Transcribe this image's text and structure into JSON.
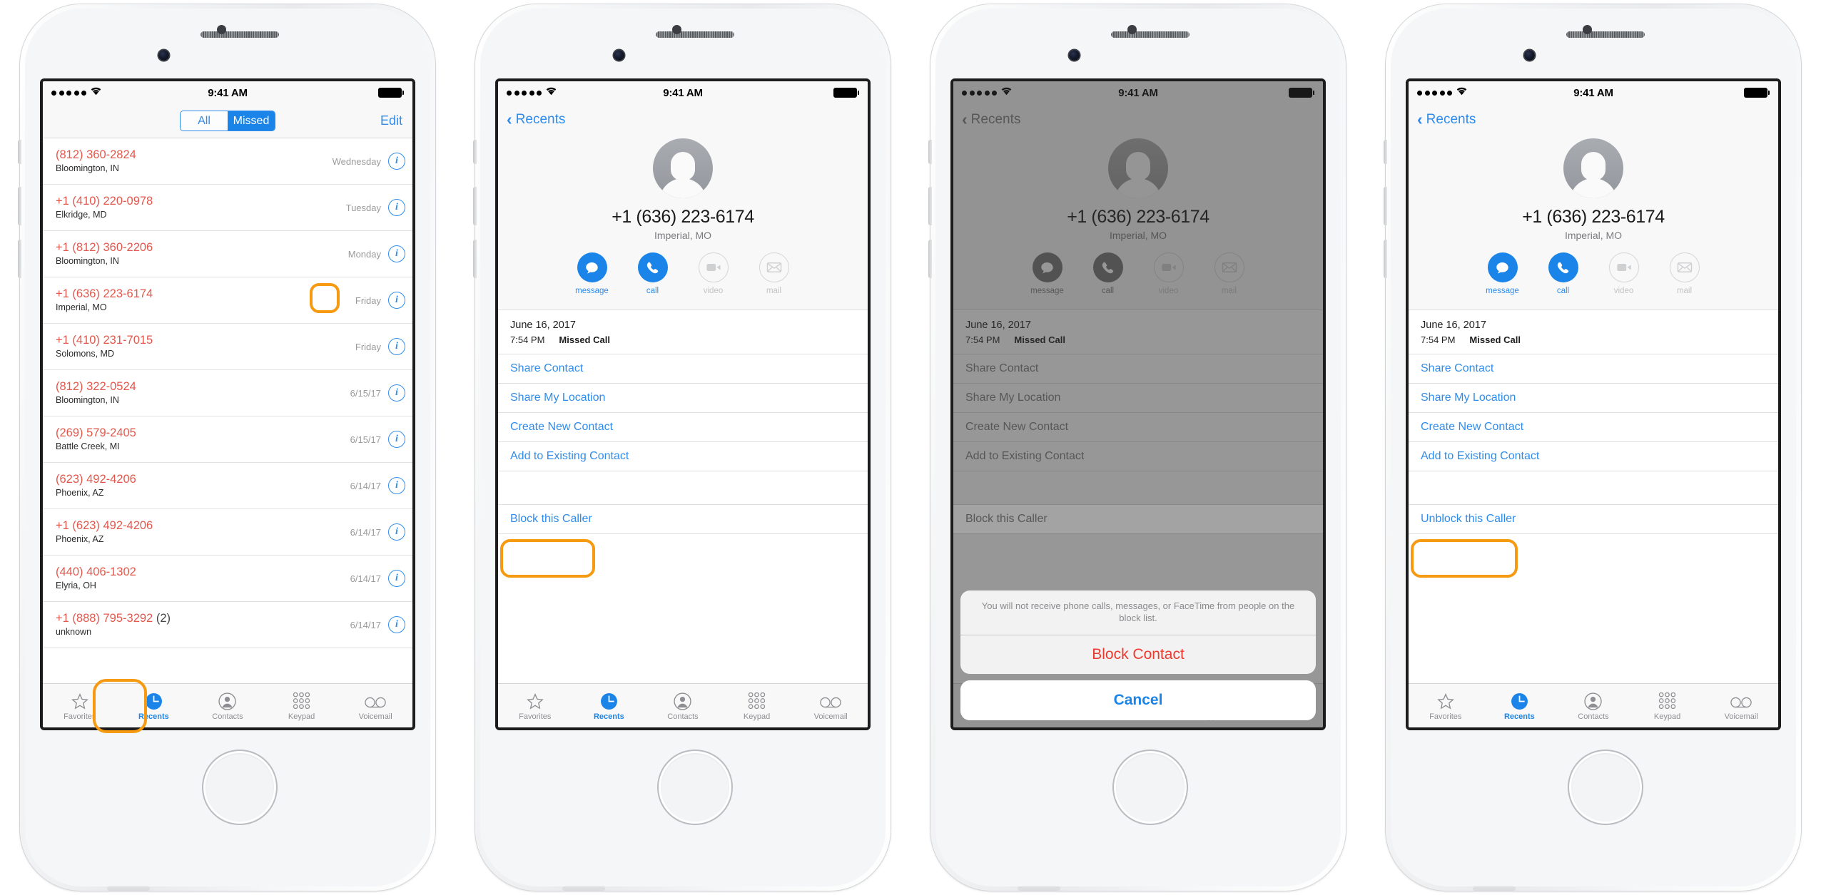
{
  "status_bar": {
    "time": "9:41 AM",
    "signal_dots": 5,
    "wifi_icon": "wifi-icon",
    "battery_icon": "battery-full-icon"
  },
  "colors": {
    "accent_blue": "#1a84e8",
    "link_blue": "#2f8ceb",
    "missed_red": "#e2574c",
    "destructive_red": "#ec3b2e",
    "highlight_orange": "#f59a11",
    "grey_text": "#8e8e93"
  },
  "tab_bar": {
    "items": [
      {
        "label": "Favorites",
        "icon": "star-icon",
        "active": false
      },
      {
        "label": "Recents",
        "icon": "clock-icon",
        "active": true
      },
      {
        "label": "Contacts",
        "icon": "person-circle-icon",
        "active": false
      },
      {
        "label": "Keypad",
        "icon": "keypad-icon",
        "active": false
      },
      {
        "label": "Voicemail",
        "icon": "voicemail-icon",
        "active": false
      }
    ]
  },
  "phone1": {
    "segmented": {
      "options": [
        "All",
        "Missed"
      ],
      "selected": "Missed"
    },
    "edit_label": "Edit",
    "calls": [
      {
        "number": "(812) 360-2824",
        "count": "",
        "location": "Bloomington, IN",
        "date": "Wednesday",
        "info_icon": "info-icon",
        "highlighted": false
      },
      {
        "number": "+1 (410) 220-0978",
        "count": "",
        "location": "Elkridge, MD",
        "date": "Tuesday",
        "info_icon": "info-icon",
        "highlighted": false
      },
      {
        "number": "+1 (812) 360-2206",
        "count": "",
        "location": "Bloomington, IN",
        "date": "Monday",
        "info_icon": "info-icon",
        "highlighted": false
      },
      {
        "number": "+1 (636) 223-6174",
        "count": "",
        "location": "Imperial, MO",
        "date": "Friday",
        "info_icon": "info-icon",
        "highlighted": true
      },
      {
        "number": "+1 (410) 231-7015",
        "count": "",
        "location": "Solomons, MD",
        "date": "Friday",
        "info_icon": "info-icon",
        "highlighted": false
      },
      {
        "number": "(812) 322-0524",
        "count": "",
        "location": "Bloomington, IN",
        "date": "6/15/17",
        "info_icon": "info-icon",
        "highlighted": false
      },
      {
        "number": "(269) 579-2405",
        "count": "",
        "location": "Battle Creek, MI",
        "date": "6/15/17",
        "info_icon": "info-icon",
        "highlighted": false
      },
      {
        "number": "(623) 492-4206",
        "count": "",
        "location": "Phoenix, AZ",
        "date": "6/14/17",
        "info_icon": "info-icon",
        "highlighted": false
      },
      {
        "number": "+1 (623) 492-4206",
        "count": "",
        "location": "Phoenix, AZ",
        "date": "6/14/17",
        "info_icon": "info-icon",
        "highlighted": false
      },
      {
        "number": "(440) 406-1302",
        "count": "",
        "location": "Elyria, OH",
        "date": "6/14/17",
        "info_icon": "info-icon",
        "highlighted": false
      },
      {
        "number": "+1 (888) 795-3292",
        "count": "(2)",
        "location": "unknown",
        "date": "6/14/17",
        "info_icon": "info-icon",
        "highlighted": false
      }
    ]
  },
  "detail": {
    "back_label": "Recents",
    "avatar_icon": "person-placeholder-avatar",
    "number": "+1 (636) 223-6174",
    "location": "Imperial, MO",
    "actions": [
      {
        "label": "message",
        "icon": "message-bubble-icon",
        "enabled": true
      },
      {
        "label": "call",
        "icon": "phone-handset-icon",
        "enabled": true
      },
      {
        "label": "video",
        "icon": "video-camera-icon",
        "enabled": false
      },
      {
        "label": "mail",
        "icon": "envelope-icon",
        "enabled": false
      }
    ],
    "call_date": "June 16, 2017",
    "call_time": "7:54 PM",
    "call_type": "Missed Call",
    "options": [
      "Share Contact",
      "Share My Location",
      "Create New Contact",
      "Add to Existing Contact"
    ],
    "block_label": "Block this Caller",
    "unblock_label": "Unblock this Caller"
  },
  "action_sheet": {
    "message": "You will not receive phone calls, messages, or FaceTime from people on the block list.",
    "confirm_label": "Block Contact",
    "cancel_label": "Cancel"
  }
}
